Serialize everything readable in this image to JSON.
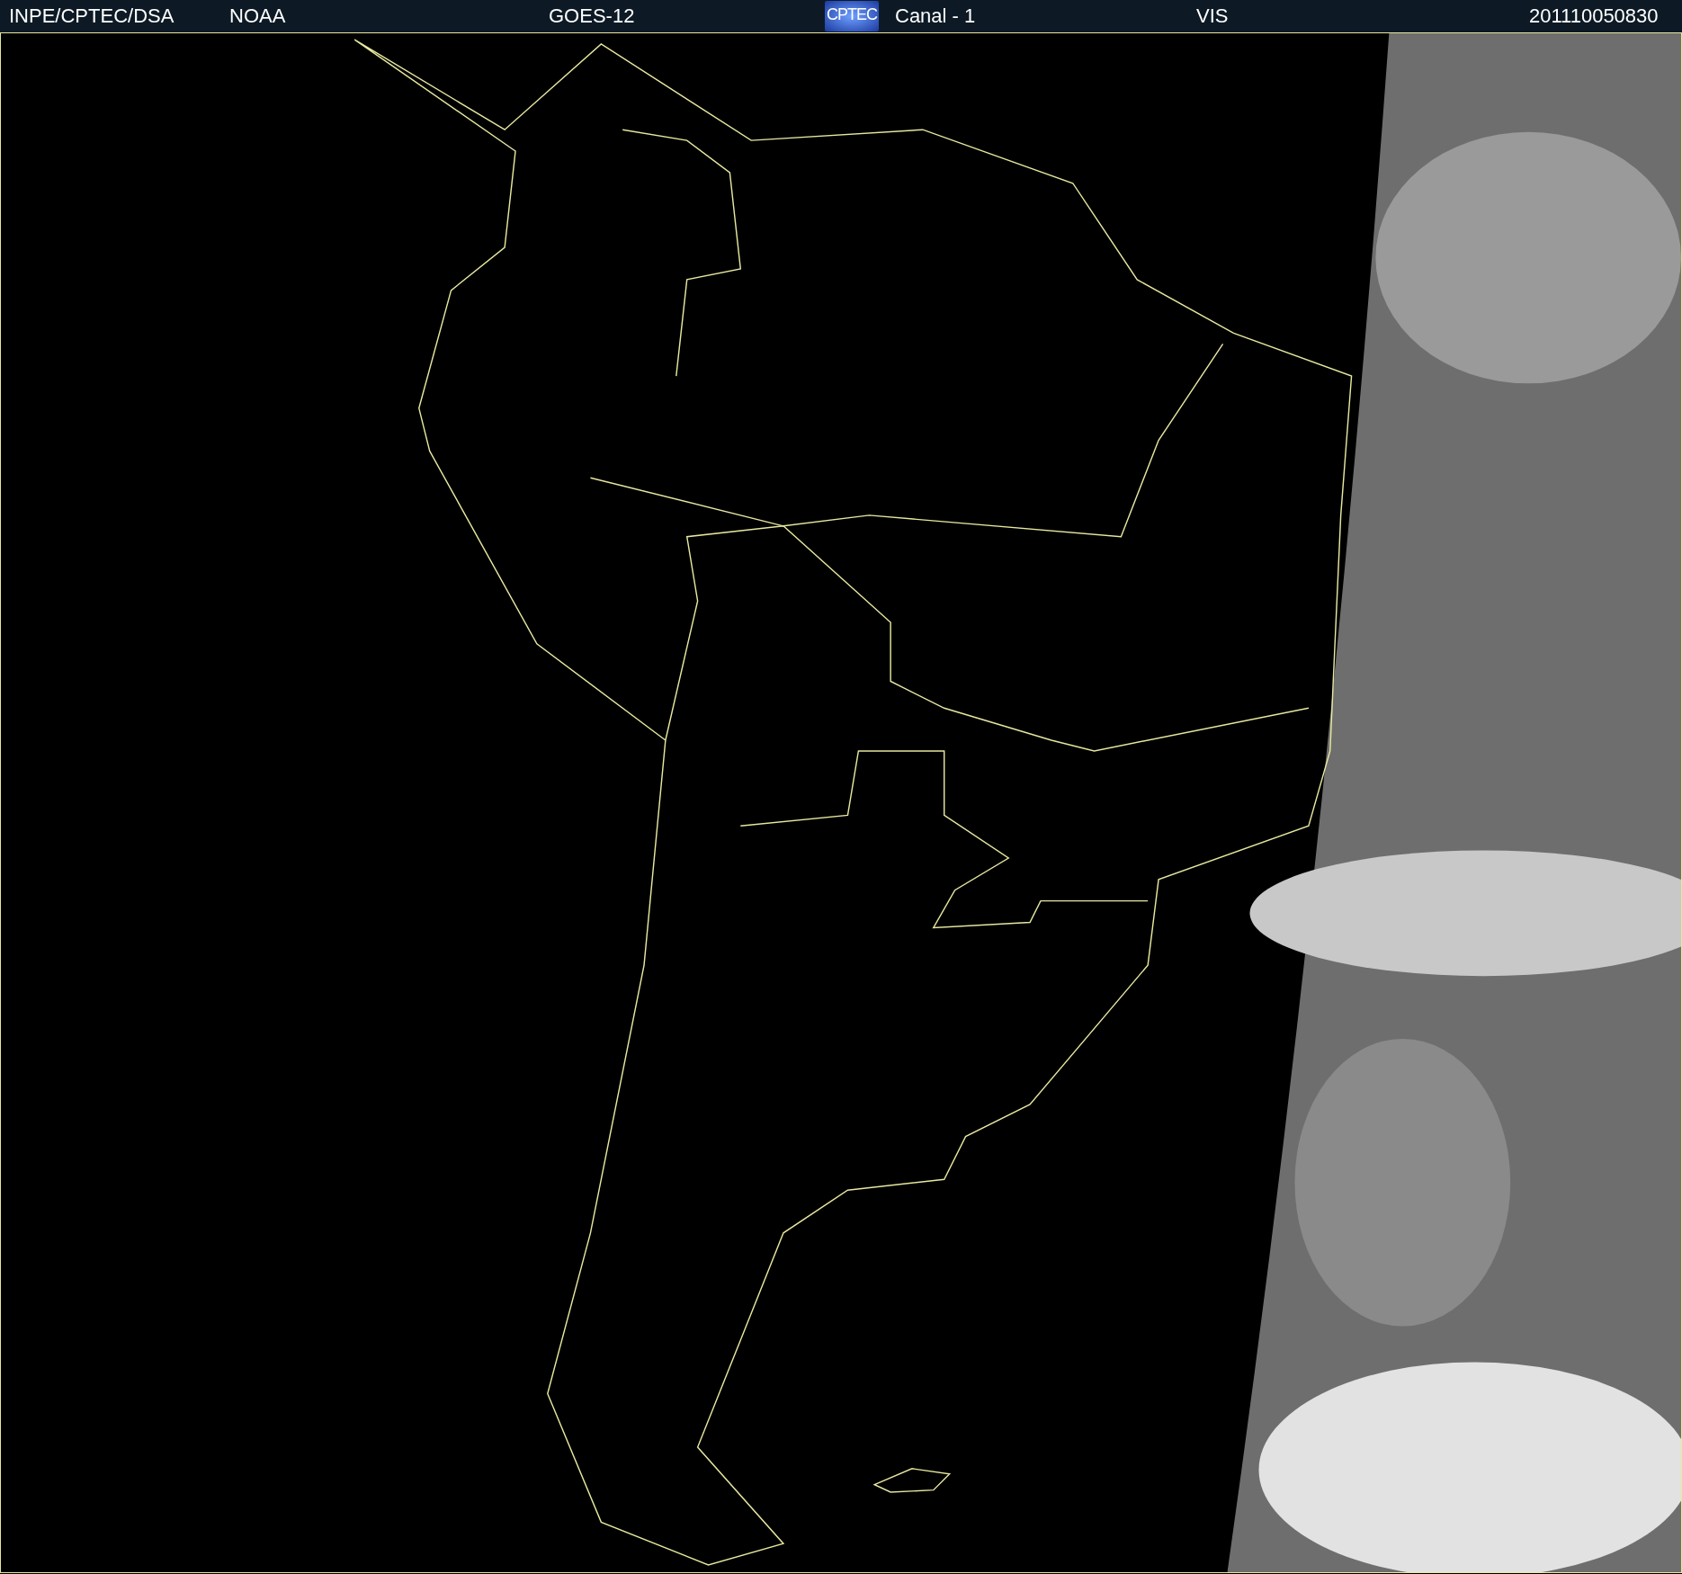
{
  "header": {
    "source": "INPE/CPTEC/DSA",
    "agency": "NOAA",
    "satellite": "GOES-12",
    "logo": "CPTEC",
    "channel": "Canal - 1",
    "band": "VIS",
    "timestamp": "201110050830"
  }
}
